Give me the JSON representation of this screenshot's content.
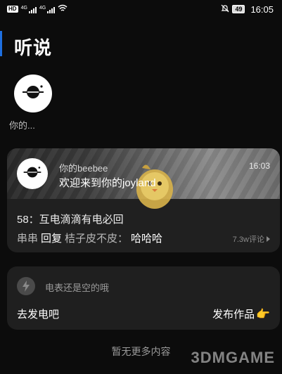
{
  "status_bar": {
    "hd_badge": "HD",
    "signal_1": "4G",
    "signal_2": "4G",
    "battery": "49",
    "time": "16:05"
  },
  "header": {
    "title": "听说"
  },
  "top_avatar": {
    "name": "你的..."
  },
  "message_card": {
    "sender": "你的beebee",
    "text": "欢迎来到你的joyland",
    "time": "16:03",
    "post_title": "58：互电滴滴有电必回",
    "reply": {
      "user": "串串",
      "action": "回复",
      "target": "桔子皮不皮：",
      "text": "哈哈哈"
    },
    "comments": "7.3w评论"
  },
  "electricity_card": {
    "status": "电表还是空的哦",
    "charge_label": "去发电吧",
    "publish_label": "发布作品",
    "publish_emoji": "👉"
  },
  "footer": {
    "no_more": "暂无更多内容"
  },
  "watermark": "3DMGAME",
  "colors": {
    "background": "#0c0c0c",
    "card": "#202020",
    "accent": "#1e6fe0"
  },
  "icons": [
    "wifi-icon",
    "mute-icon",
    "logo-icon",
    "bolt-icon",
    "chevron-right-icon",
    "hand-point-icon"
  ]
}
